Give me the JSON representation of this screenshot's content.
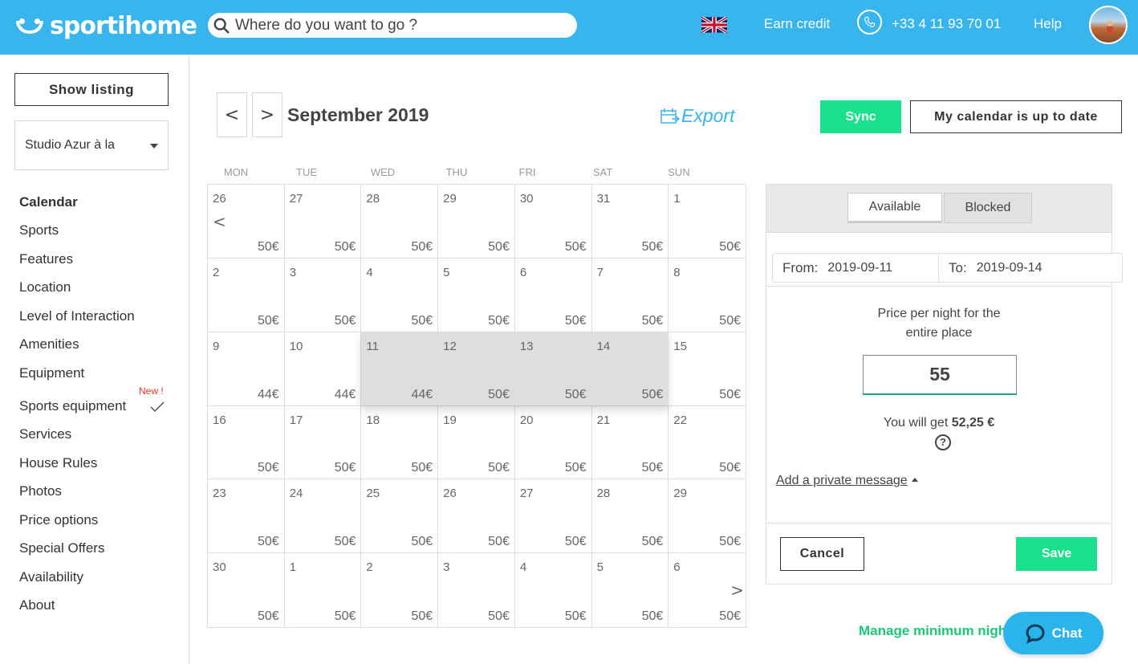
{
  "header": {
    "logo": "sportihome",
    "search_placeholder": "Where do you want to go ?",
    "earn_credit": "Earn credit",
    "phone": "+33 4 11 93 70 01",
    "help": "Help"
  },
  "sidebar": {
    "show_listing": "Show listing",
    "listing_name": "Studio Azur à la",
    "new_badge": "New !",
    "items": [
      {
        "label": "Calendar",
        "active": true
      },
      {
        "label": "Sports"
      },
      {
        "label": "Features"
      },
      {
        "label": "Location"
      },
      {
        "label": "Level of Interaction"
      },
      {
        "label": "Amenities"
      },
      {
        "label": "Equipment"
      },
      {
        "label": "Sports equipment"
      },
      {
        "label": "Services"
      },
      {
        "label": "House Rules"
      },
      {
        "label": "Photos"
      },
      {
        "label": "Price options"
      },
      {
        "label": "Special Offers"
      },
      {
        "label": "Availability"
      },
      {
        "label": "About"
      }
    ]
  },
  "calendar": {
    "prev": "<",
    "next": ">",
    "month": "September 2019",
    "export": "Export",
    "sync": "Sync",
    "up_to_date": "My calendar is up to date",
    "weekdays": [
      "MON",
      "TUE",
      "WED",
      "THU",
      "FRI",
      "SAT",
      "SUN"
    ],
    "weeks": [
      [
        {
          "d": "26",
          "p": "50€"
        },
        {
          "d": "27",
          "p": "50€"
        },
        {
          "d": "28",
          "p": "50€"
        },
        {
          "d": "29",
          "p": "50€"
        },
        {
          "d": "30",
          "p": "50€"
        },
        {
          "d": "31",
          "p": "50€"
        },
        {
          "d": "1",
          "p": "50€"
        }
      ],
      [
        {
          "d": "2",
          "p": "50€"
        },
        {
          "d": "3",
          "p": "50€"
        },
        {
          "d": "4",
          "p": "50€"
        },
        {
          "d": "5",
          "p": "50€"
        },
        {
          "d": "6",
          "p": "50€"
        },
        {
          "d": "7",
          "p": "50€"
        },
        {
          "d": "8",
          "p": "50€"
        }
      ],
      [
        {
          "d": "9",
          "p": "44€"
        },
        {
          "d": "10",
          "p": "44€"
        },
        {
          "d": "11",
          "p": "44€",
          "sel": true
        },
        {
          "d": "12",
          "p": "50€",
          "sel": true
        },
        {
          "d": "13",
          "p": "50€",
          "sel": true
        },
        {
          "d": "14",
          "p": "50€",
          "sel": true
        },
        {
          "d": "15",
          "p": "50€"
        }
      ],
      [
        {
          "d": "16",
          "p": "50€"
        },
        {
          "d": "17",
          "p": "50€"
        },
        {
          "d": "18",
          "p": "50€"
        },
        {
          "d": "19",
          "p": "50€"
        },
        {
          "d": "20",
          "p": "50€"
        },
        {
          "d": "21",
          "p": "50€"
        },
        {
          "d": "22",
          "p": "50€"
        }
      ],
      [
        {
          "d": "23",
          "p": "50€"
        },
        {
          "d": "24",
          "p": "50€"
        },
        {
          "d": "25",
          "p": "50€"
        },
        {
          "d": "26",
          "p": "50€"
        },
        {
          "d": "27",
          "p": "50€"
        },
        {
          "d": "28",
          "p": "50€"
        },
        {
          "d": "29",
          "p": "50€"
        }
      ],
      [
        {
          "d": "30",
          "p": "50€"
        },
        {
          "d": "1",
          "p": "50€"
        },
        {
          "d": "2",
          "p": "50€"
        },
        {
          "d": "3",
          "p": "50€"
        },
        {
          "d": "4",
          "p": "50€"
        },
        {
          "d": "5",
          "p": "50€"
        },
        {
          "d": "6",
          "p": "50€"
        }
      ]
    ],
    "grid_prev": "<",
    "grid_next": ">"
  },
  "panel": {
    "tab_available": "Available",
    "tab_blocked": "Blocked",
    "from_label": "From:",
    "from_value": "2019-09-11",
    "to_label": "To:",
    "to_value": "2019-09-14",
    "price_title_1": "Price per night for the",
    "price_title_2": "entire place",
    "price_value": "55",
    "you_get_prefix": "You will get ",
    "you_get_amount": "52,25 €",
    "help_glyph": "?",
    "private_message": "Add a private message",
    "cancel": "Cancel",
    "save": "Save"
  },
  "footer": {
    "min_nights": "Manage minimum nigh",
    "chat": "Chat"
  },
  "colors": {
    "header_bg": "#37b5ec",
    "accent_green": "#19e08b",
    "selected_cell": "#dcdfde"
  }
}
